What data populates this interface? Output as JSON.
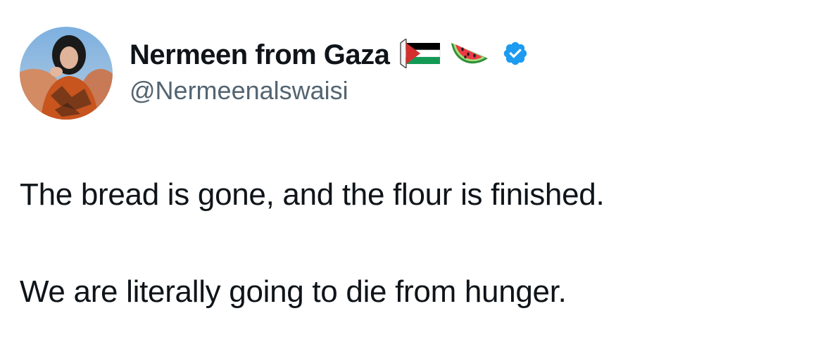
{
  "author": {
    "display_name": "Nermeen from Gaza",
    "handle": "@Nermeenalswaisi",
    "name_emoji": [
      "palestine-flag-icon",
      "watermelon-icon"
    ],
    "verified": true
  },
  "tweet": {
    "paragraphs": [
      "The bread is gone, and the flour is finished.",
      "We are literally going to die from hunger."
    ]
  },
  "colors": {
    "text_primary": "#0f1419",
    "text_secondary": "#536471",
    "verified_blue": "#1d9bf0",
    "flag_red": "#d62d2d",
    "flag_green": "#149954",
    "flag_black": "#000000"
  }
}
